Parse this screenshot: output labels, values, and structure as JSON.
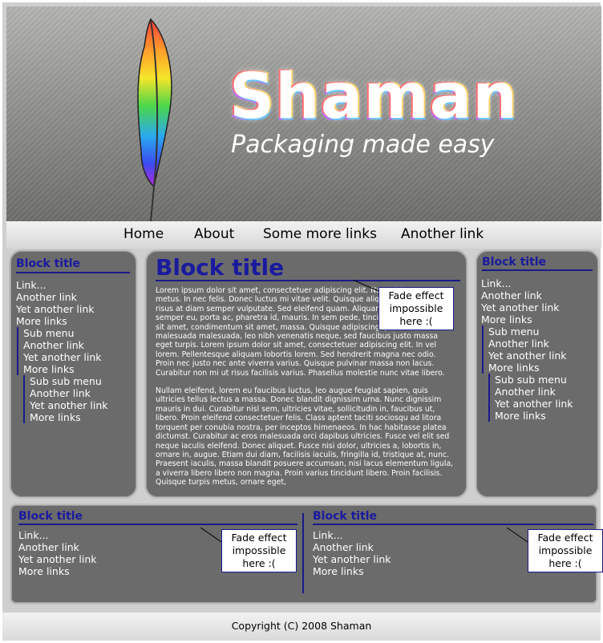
{
  "header": {
    "title": "Shaman",
    "tagline": "Packaging made easy"
  },
  "nav": [
    "Home",
    "About",
    "Some more links",
    "Another link"
  ],
  "left_block": {
    "title": "Block title",
    "links": [
      "Link...",
      "Another link",
      "Yet another link",
      "More links"
    ],
    "sub": [
      "Sub menu",
      "Another link",
      "Yet another link",
      "More links"
    ],
    "subsub": [
      "Sub sub menu",
      "Another link",
      "Yet another link",
      "More links"
    ]
  },
  "right_block": {
    "title": "Block title",
    "links": [
      "Link...",
      "Another link",
      "Yet another link",
      "More links"
    ],
    "sub": [
      "Sub menu",
      "Another link",
      "Yet another link",
      "More links"
    ],
    "subsub": [
      "Sub sub menu",
      "Another link",
      "Yet another link",
      "More links"
    ]
  },
  "main": {
    "title": "Block title",
    "paragraph1": "Lorem ipsum dolor sit amet, consectetuer adipiscing elit. Nam nisl. Maecenas metus. In nec felis. Donec luctus mi vitae velit. Quisque aliquam est. Mauris at risus at diam semper vulputate. Sed eleifend quam. Aliquam tellus augue, semper eu, porta ac, pharetra id, mauris. In sem pede, tincidunt ut, interdum sit amet, condimentum sit amet, massa. Quisque adipiscing, purus non malesuada malesuada, leo nibh venenatis neque, sed faucibus justo massa eget turpis. Lorem ipsum dolor sit amet, consectetuer adipiscing elit. In vel lorem. Pellentesque aliquam lobortis lorem. Sed hendrerit magna nec odio. Proin nec justo nec ante viverra varius. Quisque pulvinar massa non lacus. Curabitur non mi ut risus facilisis varius. Phasellus molestie nunc vitae libero.",
    "paragraph2": "Nullam eleifend, lorem eu faucibus luctus, leo augue feugiat sapien, quis ultricies tellus lectus a massa. Donec blandit dignissim urna. Nunc dignissim mauris in dui. Curabitur nisl sem, ultricies vitae, sollicitudin in, faucibus ut, libero. Proin eleifend consectetuer felis. Class aptent taciti sociosqu ad litora torquent per conubia nostra, per inceptos himenaeos. In hac habitasse platea dictumst. Curabitur ac eros malesuada orci dapibus ultricies. Fusce vel elit sed neque iaculis eleifend. Donec aliquet. Fusce nisi dolor, ultricies a, lobortis in, ornare in, augue. Etiam dui diam, facilisis iaculis, fringilla id, tristique at, nunc.  Praesent iaculis, massa blandit posuere accumsan, nisi lacus elementum ligula, a viverra libero libero non magna. Proin varius tincidunt libero. Proin facilisis. Quisque turpis metus, ornare eget,",
    "note": [
      "Fade effect",
      "impossible",
      "here :("
    ]
  },
  "bottom_left": {
    "title": "Block title",
    "links": [
      "Link...",
      "Another link",
      "Yet another link",
      "More links"
    ],
    "note": [
      "Fade effect",
      "impossible",
      "here :("
    ]
  },
  "bottom_right": {
    "title": "Block title",
    "links": [
      "Link...",
      "Another link",
      "Yet another link",
      "More links"
    ],
    "note": [
      "Fade effect",
      "impossible",
      "here :("
    ]
  },
  "footer": {
    "copyright": "Copyright (C) 2008 Shaman"
  },
  "colors": {
    "block_title": "#1a1a9e",
    "panel_bg": "#6b6b6b"
  }
}
